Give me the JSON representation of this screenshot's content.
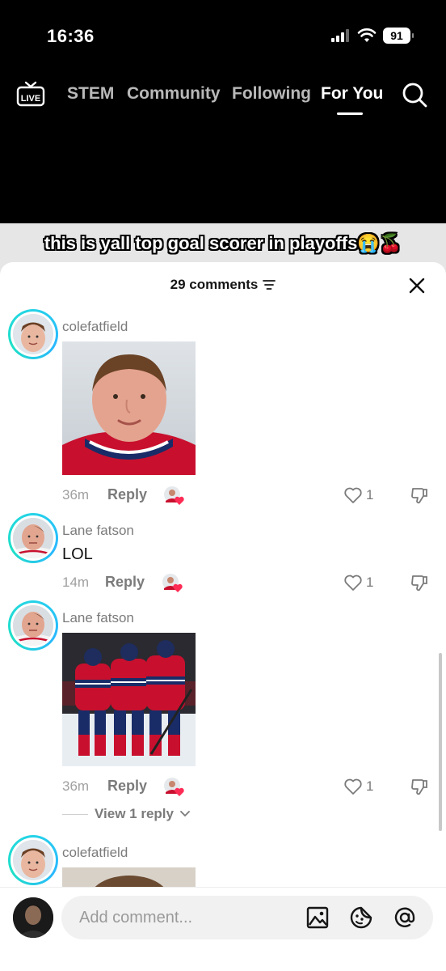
{
  "status_bar": {
    "time": "16:36",
    "battery": "91",
    "icons": [
      "cellular-signal-icon",
      "wifi-icon",
      "battery-icon"
    ]
  },
  "top_nav": {
    "live_label": "LIVE",
    "tabs": [
      {
        "label": "STEM",
        "active": false
      },
      {
        "label": "Community",
        "active": false
      },
      {
        "label": "Following",
        "active": false
      },
      {
        "label": "For You",
        "active": true
      }
    ],
    "search_icon": "search-icon"
  },
  "video": {
    "caption": "this is yall top goal scorer in playoffs😭🍒"
  },
  "comments_sheet": {
    "count_label": "29 comments",
    "filter_icon": "filter-icon",
    "close_icon": "close-icon",
    "comments": [
      {
        "username": "colefatfield",
        "text": "",
        "has_image": true,
        "image": "Canadiens player headshot",
        "time": "36m",
        "reply_label": "Reply",
        "likes": "1"
      },
      {
        "username": "Lane fatson",
        "text": "LOL",
        "has_image": false,
        "time": "14m",
        "reply_label": "Reply",
        "likes": "1"
      },
      {
        "username": "Lane fatson",
        "text": "",
        "has_image": true,
        "image": "Canadiens players celebrating on ice",
        "time": "36m",
        "reply_label": "Reply",
        "likes": "1",
        "view_replies": "View 1 reply"
      },
      {
        "username": "colefatfield",
        "text": "",
        "has_image": true
      }
    ]
  },
  "composer": {
    "placeholder": "Add comment...",
    "icons": [
      "image-icon",
      "sticker-icon",
      "mention-icon"
    ]
  },
  "colors": {
    "avatar_ring": "#24d3e8",
    "like_red": "#fe2c55",
    "habs_red": "#c8102e",
    "habs_blue": "#192c68"
  }
}
